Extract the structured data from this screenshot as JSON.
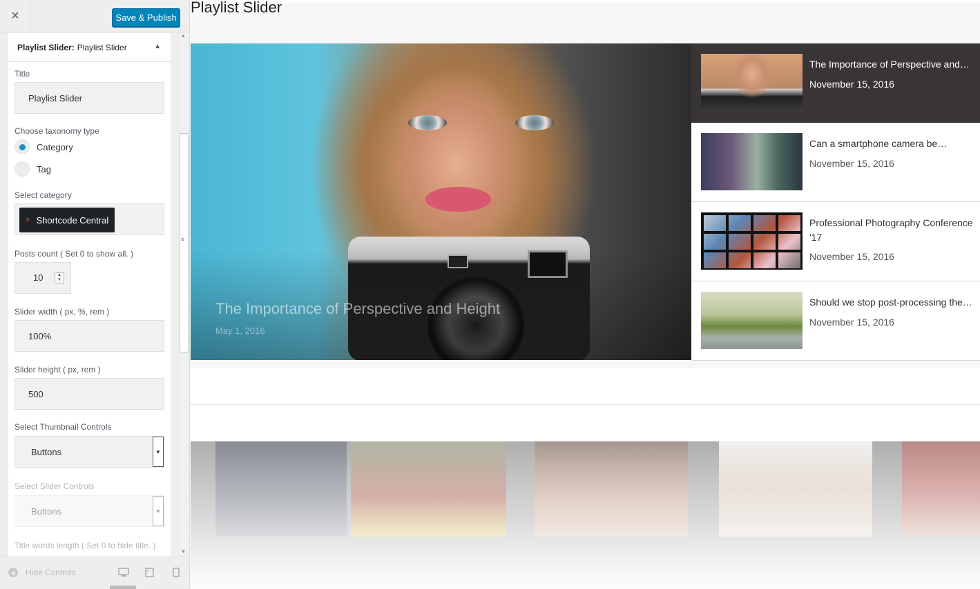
{
  "header": {
    "close_label": "×",
    "publish_label": "Save & Publish"
  },
  "section": {
    "title_bold": "Playlist Slider:",
    "title_rest": "Playlist Slider",
    "collapse_arrow": "▲"
  },
  "form": {
    "title_label": "Title",
    "title_value": "Playlist Slider",
    "taxonomy_label": "Choose taxonomy type",
    "taxonomy_options": [
      "Category",
      "Tag"
    ],
    "taxonomy_selected": "Category",
    "category_label": "Select category",
    "category_token": "Shortcode Central",
    "category_token_remove": "×",
    "posts_count_label": "Posts count ( Set 0 to show all. )",
    "posts_count_value": "10",
    "slider_width_label": "Slider width ( px, %, rem )",
    "slider_width_value": "100%",
    "slider_height_label": "Slider height ( px, rem )",
    "slider_height_value": "500",
    "thumb_controls_label": "Select Thumbnail Controls",
    "thumb_controls_value": "Buttons",
    "slider_controls_label": "Select Slider Controls",
    "slider_controls_value": "Buttons",
    "title_words_label": "Title words length ( Set 0 to hide title. )"
  },
  "footer": {
    "hide_controls_label": "Hide Controls",
    "devices": [
      "desktop-icon",
      "tablet-icon",
      "mobile-icon"
    ]
  },
  "preview": {
    "widget_title": "Playlist Slider",
    "main_slide": {
      "caption": "The Importance of Perspective and Height",
      "date": "May 1, 2016"
    },
    "playlist": [
      {
        "title": "The Importance of Perspective and…",
        "date": "November 15, 2016",
        "active": true
      },
      {
        "title": "Can a smartphone camera be…",
        "date": "November 15, 2016",
        "active": false
      },
      {
        "title": "Professional Photography Conference '17",
        "date": "November 15, 2016",
        "active": false
      },
      {
        "title": "Should we stop post-processing the…",
        "date": "November 15, 2016",
        "active": false
      }
    ]
  },
  "colors": {
    "accent": "#0085ba",
    "radio_on": "#1e8cbe",
    "active_item_bg": "#3a3535",
    "token_bg": "#1d2327"
  }
}
